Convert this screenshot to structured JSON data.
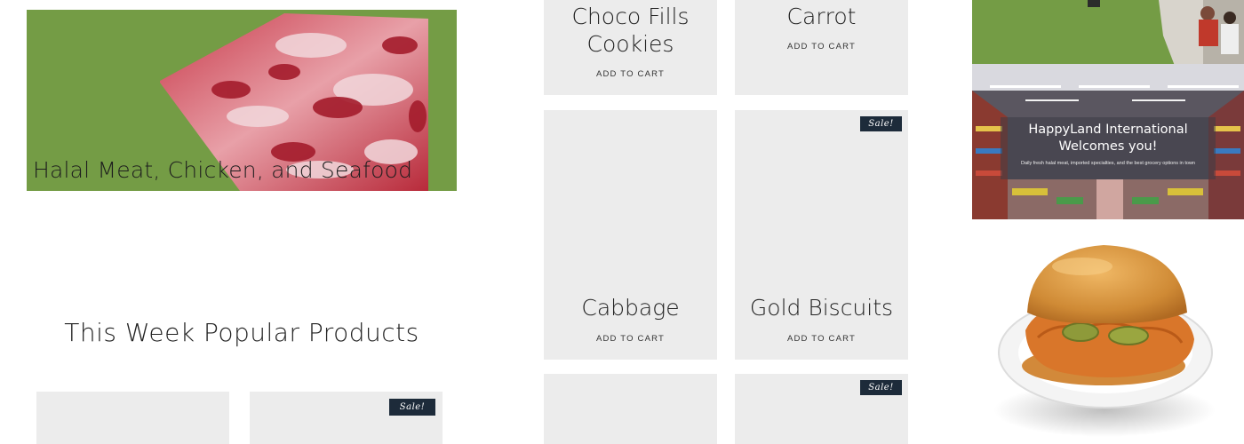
{
  "banner": {
    "title": "Halal Meat, Chicken, and Seafood"
  },
  "popular": {
    "heading": "This Week Popular Products"
  },
  "products": [
    {
      "name_line1": "Choco Fills",
      "name_line2": "Cookies",
      "cta": "ADD TO CART",
      "sale": false
    },
    {
      "name_line1": "Carrot",
      "cta": "ADD TO CART",
      "sale": false
    },
    {
      "name_line1": "Cabbage",
      "cta": "ADD TO CART",
      "sale": false
    },
    {
      "name_line1": "Gold Biscuits",
      "cta": "ADD TO CART",
      "sale": true,
      "sale_label": "Sale!"
    },
    {
      "sale": false
    },
    {
      "sale": true,
      "sale_label": "Sale!"
    },
    {
      "sale": false
    },
    {
      "sale": true,
      "sale_label": "Sale!"
    }
  ],
  "store_banner": {
    "title_line1": "HappyLand International",
    "title_line2": "Welcomes you!",
    "subtitle": "Daily fresh halal meat, imported specialties, and the best grocery options in town"
  },
  "colors": {
    "banner_green": "#749c45",
    "card_bg": "#ececec",
    "sale_badge_bg": "#1d2b3a"
  }
}
